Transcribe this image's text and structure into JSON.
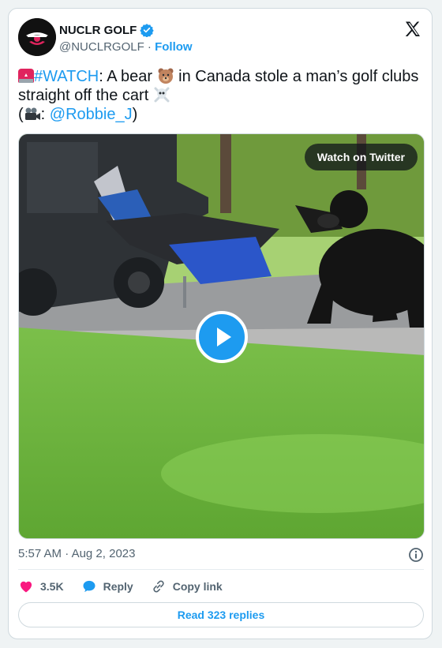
{
  "author": {
    "name": "NUCLR GOLF",
    "handle": "@NUCLRGOLF",
    "separator": "·",
    "follow_label": "Follow",
    "verified": true
  },
  "tweet": {
    "hashtag": "#WATCH",
    "text_part1": ": A bear ",
    "text_part2": " in Canada stole a man’s golf clubs straight off the cart ",
    "credit_open": "(",
    "credit_colon": ": ",
    "credit_mention": "@Robbie_J",
    "credit_close": ")"
  },
  "media": {
    "watch_label": "Watch on Twitter",
    "play_icon": "play-icon"
  },
  "meta": {
    "time": "5:57 AM",
    "separator": "·",
    "date": "Aug 2, 2023"
  },
  "actions": {
    "likes": "3.5K",
    "reply_label": "Reply",
    "copy_link_label": "Copy link"
  },
  "read_replies_label": "Read 323 replies",
  "colors": {
    "accent": "#1d9bf0",
    "like": "#f91880",
    "text": "#0f1419",
    "muted": "#536471"
  }
}
